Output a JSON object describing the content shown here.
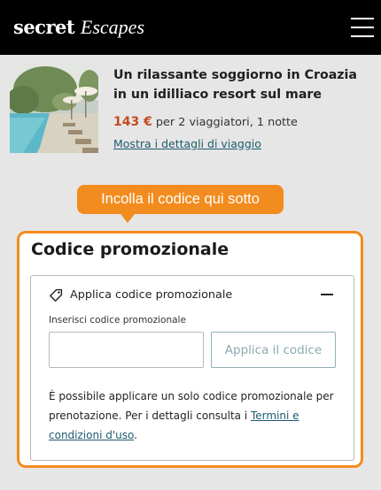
{
  "header": {
    "logo_part1": "secret",
    "logo_part2": "Escapes",
    "menu_icon": "hamburger-menu-icon",
    "text_color": "#ffffff",
    "background": "#000000"
  },
  "trip": {
    "image_icon": "resort-pool-photo",
    "title": "Un rilassante soggiorno in Croazia in un idilliaco resort sul mare",
    "price": "143 €",
    "price_suffix": "per 2 viaggiatori, 1 notte",
    "details_link": "Mostra i dettagli di viaggio",
    "price_color": "#c54b1e"
  },
  "callout": {
    "text": "Incolla il codice qui sotto",
    "color": "#f28c1e"
  },
  "promo": {
    "title": "Codice promozionale",
    "apply_header": "Applica codice promozionale",
    "tag_icon": "tag-icon",
    "collapse_icon": "minus-icon",
    "field_label": "Inserisci codice promozionale",
    "input_value": "",
    "input_placeholder": "",
    "apply_button": "Applica il codice",
    "note_text": "È possibile applicare un solo codice promozionale per prenotazione. Per i dettagli consulta i ",
    "terms_link": "Termini e condizioni d'uso",
    "note_end": ".",
    "accent_color": "#f28c1e",
    "link_color": "#1d5b6e"
  }
}
